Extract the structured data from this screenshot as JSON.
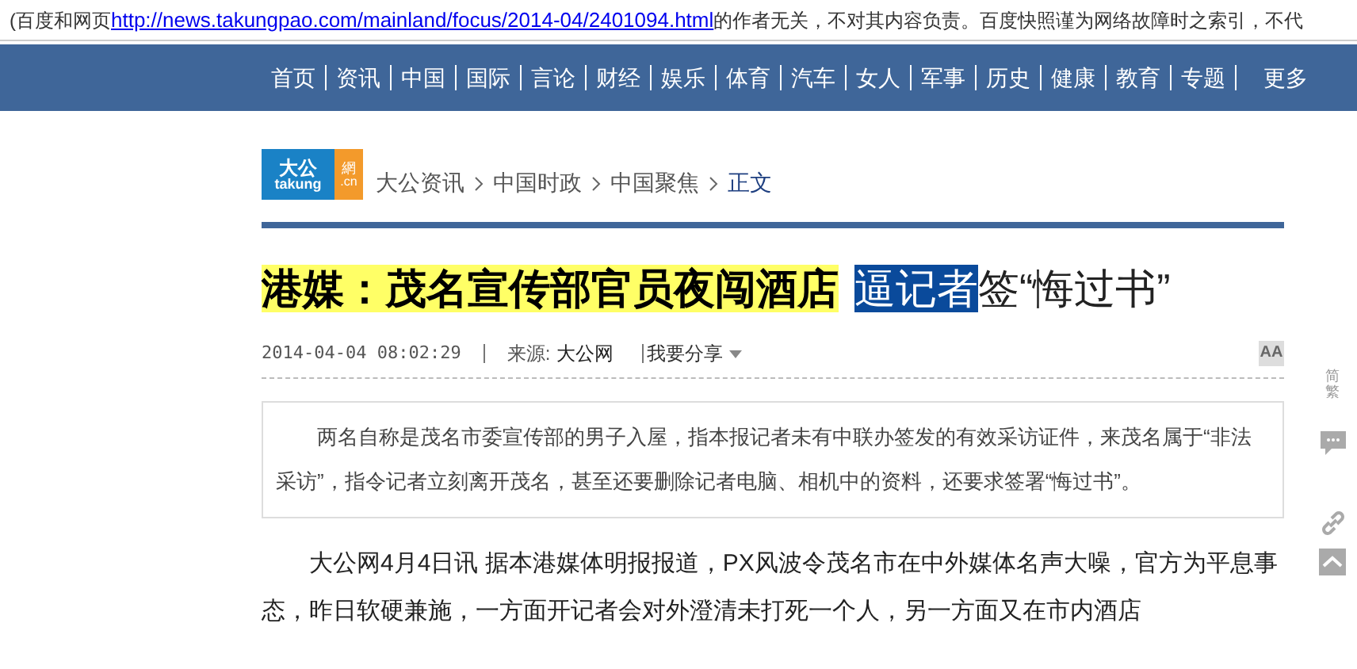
{
  "cache_notice": {
    "before": "(百度和网页",
    "link": "http://news.takungpao.com/mainland/focus/2014-04/2401094.html",
    "after": "的作者无关，不对其内容负责。百度快照谨为网络故障时之索引，不代"
  },
  "nav": {
    "items": [
      "首页",
      "资讯",
      "中国",
      "国际",
      "言论",
      "财经",
      "娱乐",
      "体育",
      "汽车",
      "女人",
      "军事",
      "历史",
      "健康",
      "教育",
      "专题"
    ],
    "more": "更多"
  },
  "logo": {
    "left_top": "大公",
    "right_top": "網",
    "left_bottom": "takung",
    "right_bottom": ".cn"
  },
  "breadcrumb": [
    {
      "label": "大公资讯",
      "current": false
    },
    {
      "label": "中国时政",
      "current": false
    },
    {
      "label": "中国聚焦",
      "current": false
    },
    {
      "label": "正文",
      "current": true
    }
  ],
  "title": [
    {
      "text": "港媒：茂名宣传部官员夜闯酒店",
      "kind": "highlight"
    },
    {
      "text": "逼记者",
      "kind": "selection"
    },
    {
      "text": "签“悔过书”",
      "kind": "plain"
    }
  ],
  "meta": {
    "time": "2014-04-04 08:02:29",
    "source_label": "来源:",
    "source": "大公网",
    "share": "我要分享"
  },
  "font_size_button": "AA",
  "summary": "两名自称是茂名市委宣传部的男子入屋，指本报记者未有中联办签发的有效采访证件，来茂名属于“非法采访”，指令记者立刻离开茂名，甚至还要删除记者电脑、相机中的资料，还要求签署“悔过书”。",
  "body": "大公网4月4日讯 据本港媒体明报报道，PX风波令茂名市在中外媒体名声大噪，官方为平息事态，昨日软硬兼施，一方面开记者会对外澄清未打死一个人，另一方面又在市内酒店",
  "side_tools": {
    "convert": "简繁"
  }
}
